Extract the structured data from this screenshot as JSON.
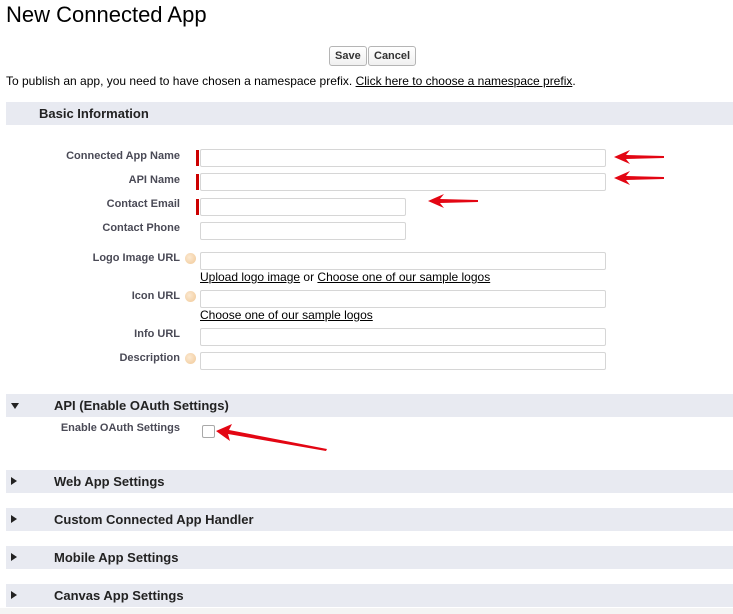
{
  "page": {
    "title": "New Connected App"
  },
  "toolbar": {
    "save_label": "Save",
    "cancel_label": "Cancel"
  },
  "notice": {
    "text": "To publish an app, you need to have chosen a namespace prefix. ",
    "link": "Click here to choose a namespace prefix",
    "suffix": "."
  },
  "sections": {
    "basic": {
      "title": "Basic Information"
    },
    "api": {
      "title": "API (Enable OAuth Settings)",
      "expanded": true
    },
    "web": {
      "title": "Web App Settings",
      "expanded": false
    },
    "handler": {
      "title": "Custom Connected App Handler",
      "expanded": false
    },
    "mobile": {
      "title": "Mobile App Settings",
      "expanded": false
    },
    "canvas": {
      "title": "Canvas App Settings",
      "expanded": false
    }
  },
  "fields": {
    "app_name": {
      "label": "Connected App Name",
      "value": "",
      "required": true
    },
    "api_name": {
      "label": "API Name",
      "value": "",
      "required": true
    },
    "contact_email": {
      "label": "Contact Email",
      "value": "",
      "required": true
    },
    "contact_phone": {
      "label": "Contact Phone",
      "value": ""
    },
    "logo_url": {
      "label": "Logo Image URL",
      "value": "",
      "link1": "Upload logo image",
      "or": " or ",
      "link2": "Choose one of our sample logos"
    },
    "icon_url": {
      "label": "Icon URL",
      "value": "",
      "link": "Choose one of our sample logos"
    },
    "info_url": {
      "label": "Info URL",
      "value": ""
    },
    "description": {
      "label": "Description",
      "value": ""
    },
    "enable_oauth": {
      "label": "Enable OAuth Settings",
      "checked": false
    }
  },
  "colors": {
    "section_bg": "#e8eaf1",
    "required": "#cc0000",
    "annotation_arrow": "#e00000"
  }
}
